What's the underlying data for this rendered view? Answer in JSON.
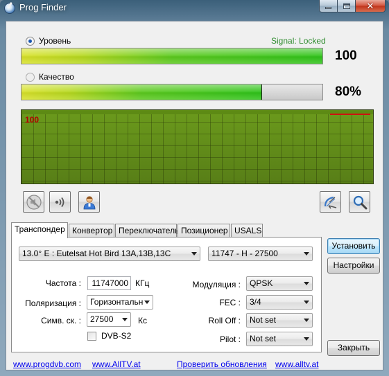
{
  "window": {
    "title": "Prog Finder"
  },
  "level": {
    "label": "Уровень",
    "status": "Signal: Locked",
    "value_text": "100",
    "percent": 100,
    "selected": true
  },
  "quality": {
    "label": "Качество",
    "value_text": "80%",
    "percent": 80,
    "selected": false
  },
  "graph": {
    "value": "100"
  },
  "tools": {
    "left": [
      "mute-speaker-icon",
      "signal-sound-icon",
      "user-person-icon"
    ],
    "right": [
      "satellite-dish-icon",
      "magnifier-search-icon"
    ]
  },
  "tabs": [
    {
      "label": "Транспондер",
      "active": true
    },
    {
      "label": "Конвертор",
      "active": false
    },
    {
      "label": "Переключатель",
      "active": false
    },
    {
      "label": "Позиционер",
      "active": false
    },
    {
      "label": "USALS",
      "active": false
    }
  ],
  "transponder": {
    "satellite": "13.0° E : Eutelsat Hot Bird 13A,13B,13C",
    "tp": "11747 - H - 27500",
    "freq_label": "Частота :",
    "freq_value": "11747000",
    "freq_unit": "КГц",
    "pol_label": "Поляризация :",
    "pol_value": "Горизонтальн",
    "sr_label": "Симв. ск. :",
    "sr_value": "27500",
    "sr_unit": "Кс",
    "dvbs2_label": "DVB-S2",
    "mod_label": "Модуляция :",
    "mod_value": "QPSK",
    "fec_label": "FEC :",
    "fec_value": "3/4",
    "rolloff_label": "Roll Off :",
    "rolloff_value": "Not set",
    "pilot_label": "Pilot :",
    "pilot_value": "Not set"
  },
  "buttons": {
    "install": "Установить",
    "settings": "Настройки",
    "close": "Закрыть"
  },
  "links": [
    "www.progdvb.com",
    "www.AllTV.at",
    "Проверить обновления",
    "www.alltv.at"
  ],
  "colors": {
    "signal_locked": "#2e8b2e",
    "graph_value": "#b00000",
    "link": "#0000ee"
  }
}
